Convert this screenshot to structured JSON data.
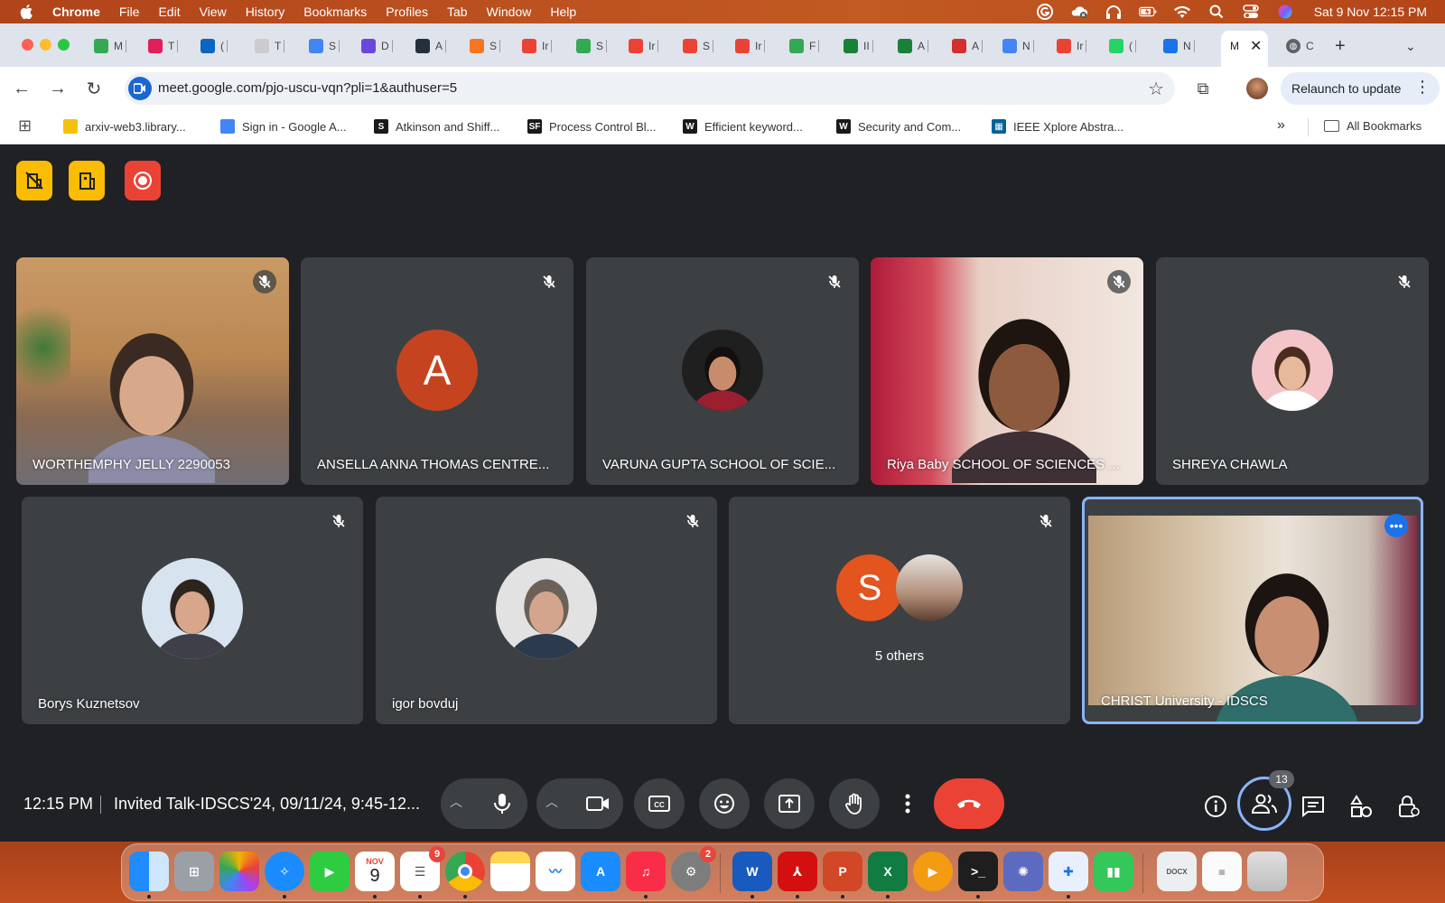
{
  "menubar": {
    "app": "Chrome",
    "items": [
      "File",
      "Edit",
      "View",
      "History",
      "Bookmarks",
      "Profiles",
      "Tab",
      "Window",
      "Help"
    ],
    "clock": "Sat 9 Nov  12:15 PM"
  },
  "tabs": [
    {
      "title": "M",
      "icon": "google-drive-icon",
      "color": "#34a853"
    },
    {
      "title": "T",
      "icon": "slack-icon",
      "color": "#e01e5a"
    },
    {
      "title": "(",
      "icon": "linkedin-icon",
      "color": "#0a66c2"
    },
    {
      "title": "T",
      "icon": "page-icon",
      "color": "#cccccc"
    },
    {
      "title": "S",
      "icon": "google-docs-icon",
      "color": "#4285f4"
    },
    {
      "title": "D",
      "icon": "shield-icon",
      "color": "#6b47dc"
    },
    {
      "title": "A",
      "icon": "aws-icon",
      "color": "#232f3e"
    },
    {
      "title": "S",
      "icon": "cube-icon",
      "color": "#f7761f"
    },
    {
      "title": "Ir",
      "icon": "gmail-icon",
      "color": "#ea4335"
    },
    {
      "title": "S",
      "icon": "google-drive-icon",
      "color": "#34a853"
    },
    {
      "title": "Ir",
      "icon": "gmail-icon",
      "color": "#ea4335"
    },
    {
      "title": "S",
      "icon": "gmail-icon",
      "color": "#ea4335"
    },
    {
      "title": "Ir",
      "icon": "gmail-icon",
      "color": "#ea4335"
    },
    {
      "title": "F",
      "icon": "google-drive-icon",
      "color": "#34a853"
    },
    {
      "title": "II",
      "icon": "google-sheets-icon",
      "color": "#188038"
    },
    {
      "title": "A",
      "icon": "google-sheets-icon",
      "color": "#188038"
    },
    {
      "title": "A",
      "icon": "springer-icon",
      "color": "#d32f2f"
    },
    {
      "title": "N",
      "icon": "google-docs-icon",
      "color": "#4285f4"
    },
    {
      "title": "Ir",
      "icon": "gmail-icon",
      "color": "#ea4335"
    },
    {
      "title": "(",
      "icon": "whatsapp-icon",
      "color": "#25d366"
    },
    {
      "title": "N",
      "icon": "app-store-icon",
      "color": "#1a73e8"
    }
  ],
  "active_tab": {
    "title": "M",
    "close": "✕"
  },
  "last_tab": {
    "title": "C"
  },
  "new_tab": "+",
  "toolbar": {
    "url": "meet.google.com/pjo-uscu-vqn?pli=1&authuser=5",
    "relaunch": "Relaunch to update"
  },
  "bookmarks": {
    "items": [
      {
        "label": "arxiv-web3.library...",
        "icon": "smiley-icon",
        "color": "#f4c20d"
      },
      {
        "label": "Sign in - Google A...",
        "icon": "google-icon",
        "color": "#4285f4"
      },
      {
        "label": "Atkinson and Shiff...",
        "icon": "scribd-icon",
        "color": "#1a1a1a",
        "glyph": "S"
      },
      {
        "label": "Process Control Bl...",
        "icon": "sf-icon",
        "color": "#1a1a1a",
        "glyph": "SF"
      },
      {
        "label": "Efficient keyword...",
        "icon": "wikipedia-icon",
        "color": "#1a1a1a",
        "glyph": "W"
      },
      {
        "label": "Security and Com...",
        "icon": "wikipedia-icon",
        "color": "#1a1a1a",
        "glyph": "W"
      },
      {
        "label": "IEEE Xplore Abstra...",
        "icon": "ieee-icon",
        "color": "#00629b",
        "glyph": "▦"
      }
    ],
    "all_bookmarks": "All Bookmarks",
    "overflow": "»"
  },
  "tiles_row1": [
    {
      "name": "WORTHEMPHY JELLY 2290053",
      "kind": "video-a"
    },
    {
      "name": "ANSELLA ANNA THOMAS CENTRE...",
      "kind": "letter",
      "letter": "A",
      "color": "#c5441f"
    },
    {
      "name": "VARUNA GUPTA SCHOOL OF SCIE...",
      "kind": "photo-a"
    },
    {
      "name": "Riya Baby SCHOOL OF SCIENCES ...",
      "kind": "video-b"
    },
    {
      "name": "SHREYA CHAWLA",
      "kind": "photo-b"
    }
  ],
  "tiles_row2": [
    {
      "name": "Borys Kuznetsov",
      "kind": "photo-c"
    },
    {
      "name": "igor bovduj",
      "kind": "photo-d"
    },
    {
      "name": "5 others",
      "kind": "others",
      "letter": "S",
      "color": "#e3541f"
    },
    {
      "name": "CHRIST University - IDSCS",
      "kind": "video-c"
    }
  ],
  "controls": {
    "time": "12:15 PM",
    "title": "Invited Talk-IDSCS'24, 09/11/24, 9:45-12...",
    "participant_count": "13",
    "end_call_color": "#ea4335"
  },
  "dock": {
    "calendar_month": "NOV",
    "calendar_day": "9",
    "reminders_badge": "9",
    "settings_badge": "2"
  }
}
